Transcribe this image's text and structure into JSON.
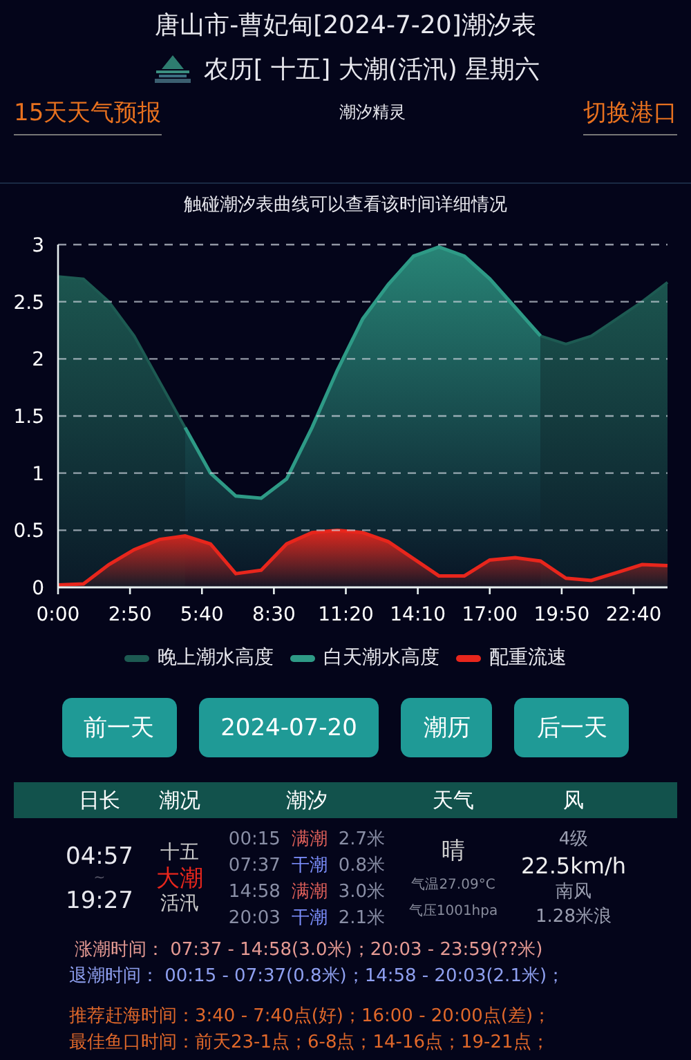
{
  "header": {
    "title": "唐山市-曹妃甸[2024-7-20]潮汐表",
    "lunar": "农历[ 十五] 大潮(活汛) 星期六"
  },
  "nav": {
    "left_link": "15天天气预报",
    "center": "潮汐精灵",
    "right_link": "切换港口"
  },
  "chart": {
    "hint": "触碰潮汐表曲线可以查看该时间详细情况",
    "chart_data": {
      "type": "area",
      "grid": true,
      "legend": "bottom",
      "x": [
        0,
        1,
        2,
        3,
        4,
        5,
        6,
        7,
        8,
        9,
        10,
        11,
        12,
        13,
        14,
        15,
        16,
        17,
        18,
        19,
        20,
        21,
        22,
        23,
        24
      ],
      "xlim": [
        0,
        24
      ],
      "ylim": [
        0,
        3
      ],
      "xticks": [
        {
          "value": 0,
          "label": "0:00"
        },
        {
          "value": 2.8333,
          "label": "2:50"
        },
        {
          "value": 5.6667,
          "label": "5:40"
        },
        {
          "value": 8.5,
          "label": "8:30"
        },
        {
          "value": 11.3333,
          "label": "11:20"
        },
        {
          "value": 14.1667,
          "label": "14:10"
        },
        {
          "value": 17,
          "label": "17:00"
        },
        {
          "value": 19.8333,
          "label": "19:50"
        },
        {
          "value": 22.6667,
          "label": "22:40"
        }
      ],
      "yticks": [
        0,
        0.5,
        1,
        1.5,
        2,
        2.5,
        3
      ],
      "series": [
        {
          "name": "晚上潮水高度",
          "color": "#1d5a52",
          "values": [
            2.72,
            2.7,
            2.5,
            2.2,
            1.8,
            1.4,
            null,
            null,
            null,
            null,
            null,
            null,
            null,
            null,
            null,
            null,
            null,
            null,
            null,
            2.2,
            2.13,
            2.2,
            2.35,
            2.5,
            2.67
          ]
        },
        {
          "name": "白天潮水高度",
          "color": "#2e9a86",
          "values": [
            null,
            null,
            null,
            null,
            null,
            1.4,
            1.0,
            0.8,
            0.78,
            0.95,
            1.4,
            1.9,
            2.35,
            2.65,
            2.9,
            2.98,
            2.9,
            2.7,
            2.45,
            2.2,
            null,
            null,
            null,
            null,
            null
          ]
        },
        {
          "name": "配重流速",
          "color": "#e8261c",
          "values": [
            0.02,
            0.03,
            0.2,
            0.33,
            0.42,
            0.45,
            0.38,
            0.12,
            0.15,
            0.38,
            0.48,
            0.5,
            0.48,
            0.4,
            0.25,
            0.1,
            0.1,
            0.24,
            0.26,
            0.23,
            0.08,
            0.06,
            0.13,
            0.2,
            0.19
          ]
        }
      ]
    }
  },
  "buttons": [
    {
      "label": "前一天"
    },
    {
      "label": "2024-07-20"
    },
    {
      "label": "潮历"
    },
    {
      "label": "后一天"
    }
  ],
  "table": {
    "columns": [
      "日长",
      "潮况",
      "潮汐",
      "天气",
      "风"
    ],
    "day_length": {
      "sunrise": "04:57",
      "separator": "~",
      "sunset": "19:27"
    },
    "tide_state": {
      "lunar_day": "十五",
      "tide": "大潮",
      "surge": "活汛"
    },
    "tides": [
      {
        "time": "00:15",
        "kind": "high",
        "type": "满潮",
        "height": "2.7米"
      },
      {
        "time": "07:37",
        "kind": "low",
        "type": "干潮",
        "height": "0.8米"
      },
      {
        "time": "14:58",
        "kind": "high",
        "type": "满潮",
        "height": "3.0米"
      },
      {
        "time": "20:03",
        "kind": "low",
        "type": "干潮",
        "height": "2.1米"
      }
    ],
    "weather": {
      "condition": "晴",
      "temperature": "气温27.09°C",
      "pressure": "气压1001hpa"
    },
    "wind": {
      "force": "4级",
      "speed": "22.5km/h",
      "direction": "南风",
      "wave": "1.28米浪"
    }
  },
  "rise_fall": [
    {
      "kind": "rise",
      "label": "涨潮时间：",
      "text": "07:37 - 14:58(3.0米)；20:03 - 23:59(??米)"
    },
    {
      "kind": "fall",
      "label": "退潮时间：",
      "text": "00:15 - 07:37(0.8米)；14:58 - 20:03(2.1米)；"
    }
  ],
  "tips": [
    {
      "label": "推荐赶海时间：",
      "text": "3:40 - 7:40点(好)；16:00 - 20:00点(差)；"
    },
    {
      "label": "最佳鱼口时间：",
      "text": "前天23-1点；6-8点；14-16点；19-21点；"
    }
  ]
}
